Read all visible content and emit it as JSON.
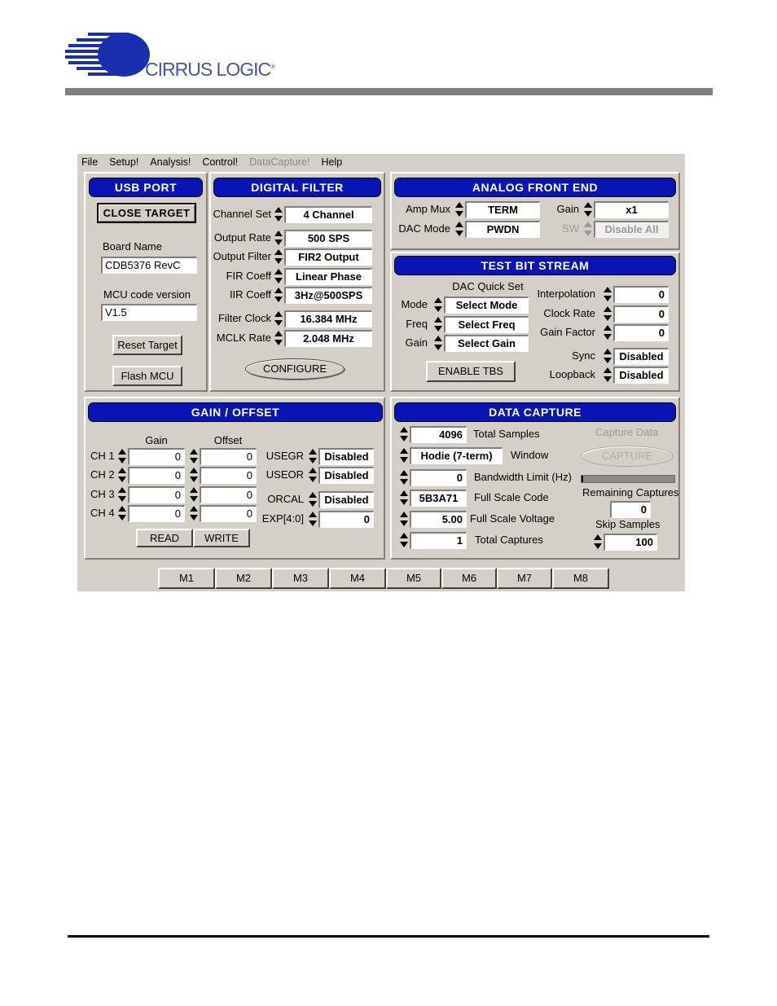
{
  "header": {
    "logo_text": "CIRRUS LOGIC"
  },
  "menu": [
    "File",
    "Setup!",
    "Analysis!",
    "Control!",
    "DataCapture!",
    "Help"
  ],
  "usb": {
    "title": "USB PORT",
    "close_target": "CLOSE TARGET",
    "board_name_label": "Board Name",
    "board_name": "CDB5376 RevC",
    "mcu_label": "MCU code version",
    "mcu_version": "V1.5",
    "reset": "Reset Target",
    "flash": "Flash MCU"
  },
  "digital_filter": {
    "title": "DIGITAL FILTER",
    "channel_set_label": "Channel Set",
    "channel_set": "4 Channel",
    "output_rate_label": "Output Rate",
    "output_rate": "500 SPS",
    "output_filter_label": "Output Filter",
    "output_filter": "FIR2 Output",
    "fir_coeff_label": "FIR Coeff",
    "fir_coeff": "Linear Phase",
    "iir_coeff_label": "IIR Coeff",
    "iir_coeff": "3Hz@500SPS",
    "filter_clock_label": "Filter Clock",
    "filter_clock": "16.384 MHz",
    "mclk_rate_label": "MCLK Rate",
    "mclk_rate": "2.048 MHz",
    "configure": "CONFIGURE"
  },
  "analog": {
    "title": "ANALOG FRONT END",
    "amp_mux_label": "Amp Mux",
    "amp_mux": "TERM",
    "dac_mode_label": "DAC Mode",
    "dac_mode": "PWDN",
    "gain_label": "Gain",
    "gain": "x1",
    "sw_label": "SW",
    "sw": "Disable All"
  },
  "tbs": {
    "title": "TEST BIT STREAM",
    "quick_set_label": "DAC Quick Set",
    "mode_label": "Mode",
    "mode": "Select Mode",
    "freq_label": "Freq",
    "freq": "Select Freq",
    "gain_label": "Gain",
    "gain": "Select Gain",
    "interp_label": "Interpolation",
    "interp": "0",
    "clock_rate_label": "Clock Rate",
    "clock_rate": "0",
    "gain_factor_label": "Gain Factor",
    "gain_factor": "0",
    "sync_label": "Sync",
    "sync": "Disabled",
    "loopback_label": "Loopback",
    "loopback": "Disabled",
    "enable": "ENABLE TBS"
  },
  "gain_offset": {
    "title": "GAIN / OFFSET",
    "gain_header": "Gain",
    "offset_header": "Offset",
    "channels": [
      {
        "label": "CH 1",
        "gain": "0",
        "offset": "0"
      },
      {
        "label": "CH 2",
        "gain": "0",
        "offset": "0"
      },
      {
        "label": "CH 3",
        "gain": "0",
        "offset": "0"
      },
      {
        "label": "CH 4",
        "gain": "0",
        "offset": "0"
      }
    ],
    "usegr_label": "USEGR",
    "usegr": "Disabled",
    "useor_label": "USEOR",
    "useor": "Disabled",
    "orcal_label": "ORCAL",
    "orcal": "Disabled",
    "exp_label": "EXP[4:0]",
    "exp": "0",
    "read": "READ",
    "write": "WRITE"
  },
  "capture": {
    "title": "DATA CAPTURE",
    "total_samples": "4096",
    "total_samples_label": "Total Samples",
    "window": "Hodie (7-term)",
    "window_label": "Window",
    "bandwidth": "0",
    "bandwidth_label": "Bandwidth Limit (Hz)",
    "full_scale_code": "5B3A71",
    "full_scale_code_label": "Full Scale Code",
    "full_scale_voltage": "5.00",
    "full_scale_voltage_label": "Full Scale Voltage",
    "total_captures": "1",
    "total_captures_label": "Total Captures",
    "capture_data_label": "Capture Data",
    "capture_button": "CAPTURE",
    "progress_fraction": 0.02,
    "remaining_label": "Remaining Captures",
    "remaining": "0",
    "skip_label": "Skip Samples",
    "skip": "100"
  },
  "tabs": [
    "M1",
    "M2",
    "M3",
    "M4",
    "M5",
    "M6",
    "M7",
    "M8"
  ]
}
